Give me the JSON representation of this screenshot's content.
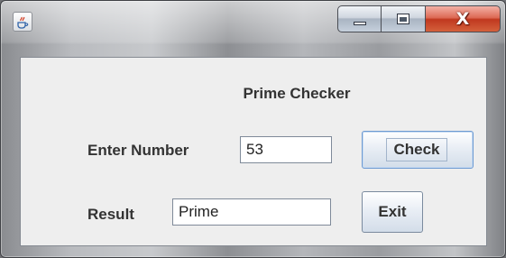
{
  "window": {
    "title": "",
    "icon": "java-cup-icon",
    "controls": {
      "minimize_icon": "minimize-icon",
      "maximize_icon": "maximize-icon",
      "close_glyph": "X"
    }
  },
  "form": {
    "heading": "Prime Checker",
    "number_label": "Enter Number",
    "number_value": "53",
    "result_label": "Result",
    "result_value": "Prime",
    "check_button": "Check",
    "exit_button": "Exit"
  },
  "colors": {
    "content_background": "#eeeeee",
    "close_button": "#c0381f",
    "focused_button_border": "#6d9ad2"
  }
}
